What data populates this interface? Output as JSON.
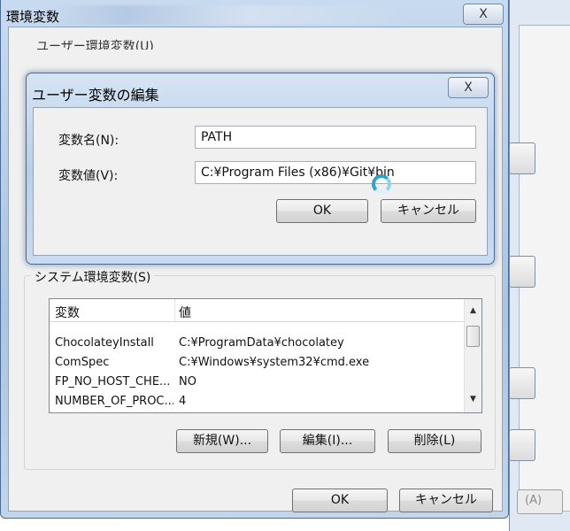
{
  "main_window": {
    "title": "環境変数",
    "close_label": "X",
    "user_group_label_partial": "ユーザー環境変数(U)",
    "system_group_label": "システム環境変数(S)",
    "system_vars": {
      "columns": [
        "変数",
        "値"
      ],
      "rows": [
        {
          "name": "ChocolateyInstall",
          "value": "C:¥ProgramData¥chocolatey"
        },
        {
          "name": "ComSpec",
          "value": "C:¥Windows¥system32¥cmd.exe"
        },
        {
          "name": "FP_NO_HOST_CHE...",
          "value": "NO"
        },
        {
          "name": "NUMBER_OF_PROC...",
          "value": "4"
        }
      ]
    },
    "buttons": {
      "new": "新規(W)...",
      "edit": "編集(I)...",
      "delete": "削除(L)",
      "ok": "OK",
      "cancel": "キャンセル"
    }
  },
  "edit_dialog": {
    "title": "ユーザー変数の編集",
    "close_label": "X",
    "name_label": "変数名(N):",
    "name_value": "PATH",
    "value_label": "変数値(V):",
    "value_value": "C:¥Program Files (x86)¥Git¥bin",
    "ok_label": "OK",
    "cancel_label": "キャンセル"
  },
  "background_window": {
    "button_label": "(A)"
  },
  "icons": {
    "close": "close-icon",
    "scroll_up": "scroll-up-icon",
    "scroll_down": "scroll-down-icon",
    "busy_cursor": "busy-cursor-icon"
  }
}
